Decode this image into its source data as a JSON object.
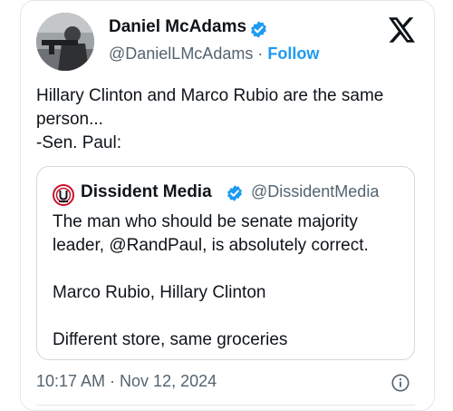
{
  "tweet": {
    "author_name": "Daniel McAdams",
    "handle": "@DanielLMcAdams",
    "separator": "·",
    "follow_label": "Follow",
    "text_lines": [
      "Hillary Clinton and Marco Rubio are the same",
      "person...",
      "-Sen. Paul:"
    ],
    "timestamp": "10:17 AM · Nov 12, 2024"
  },
  "quote": {
    "author_name": "Dissident Media",
    "handle": "@DissidentMedia",
    "text_lines": [
      "The man who should be senate majority",
      "leader, @RandPaul, is absolutely correct.",
      "",
      "Marco Rubio, Hillary Clinton",
      "",
      "Different store, same groceries"
    ]
  },
  "icons": {
    "verified": "verified-badge-icon",
    "brand": "x-logo-icon",
    "info": "info-icon",
    "quote_avatar": "dissident-media-logo-icon"
  },
  "colors": {
    "accent": "#1d9bf0",
    "text": "#0f1419",
    "muted": "#536471",
    "border": "#cfd9de",
    "dissident_red": "#c8102e"
  }
}
